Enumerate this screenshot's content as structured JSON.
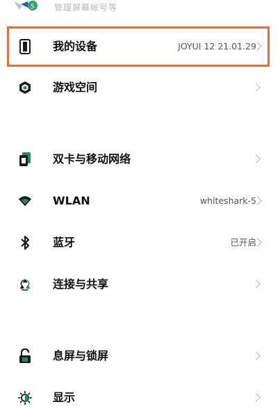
{
  "top_item": {
    "label": "管理屏幕帐号等"
  },
  "rows": [
    {
      "label": "我的设备",
      "value": "JOYUI 12 21.01.29",
      "icon": "phone-outline-icon"
    },
    {
      "label": "游戏空间",
      "value": "",
      "icon": "game-cube-icon"
    },
    {
      "label": "双卡与移动网络",
      "value": "",
      "icon": "sim-card-icon"
    },
    {
      "label": "WLAN",
      "value": "whiteshark-5",
      "icon": "wifi-icon"
    },
    {
      "label": "蓝牙",
      "value": "已开启",
      "icon": "bluetooth-icon"
    },
    {
      "label": "连接与共享",
      "value": "",
      "icon": "connection-share-icon"
    },
    {
      "label": "息屏与锁屏",
      "value": "",
      "icon": "lock-icon"
    },
    {
      "label": "显示",
      "value": "",
      "icon": "brightness-icon"
    }
  ],
  "colors": {
    "highlight": "#e26e3d",
    "icon_green": "#1e8f5f",
    "icon_dark": "#2b2b2b"
  }
}
